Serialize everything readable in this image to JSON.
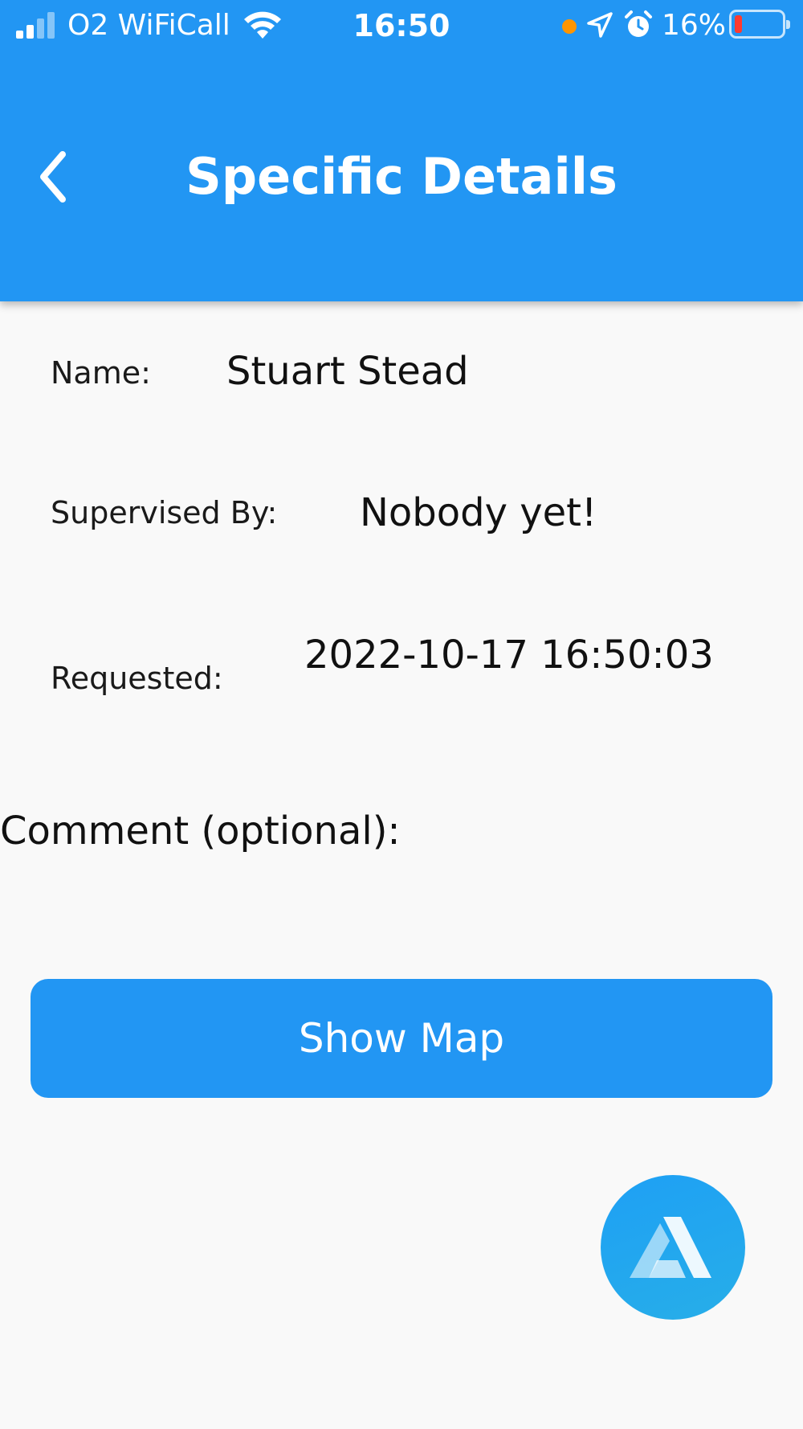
{
  "status_bar": {
    "carrier": "O2 WiFiCall",
    "time": "16:50",
    "battery_percent": "16%",
    "battery_level": 0.16,
    "signal_bars": 2,
    "colors": {
      "recording_dot": "#ff9500",
      "battery_low": "#ff3b30"
    }
  },
  "header": {
    "title": "Specific Details",
    "back_icon": "chevron-left-icon",
    "background": "#2296f3"
  },
  "details": {
    "name_label": "Name:",
    "name_value": "Stuart Stead",
    "supervised_label": "Supervised By:",
    "supervised_value": "Nobody yet!",
    "requested_label": "Requested:",
    "requested_value": "2022-10-17 16:50:03"
  },
  "comment": {
    "label": "Comment (optional):"
  },
  "actions": {
    "show_map_label": "Show Map",
    "fab_icon": "assistant-logo-icon"
  }
}
